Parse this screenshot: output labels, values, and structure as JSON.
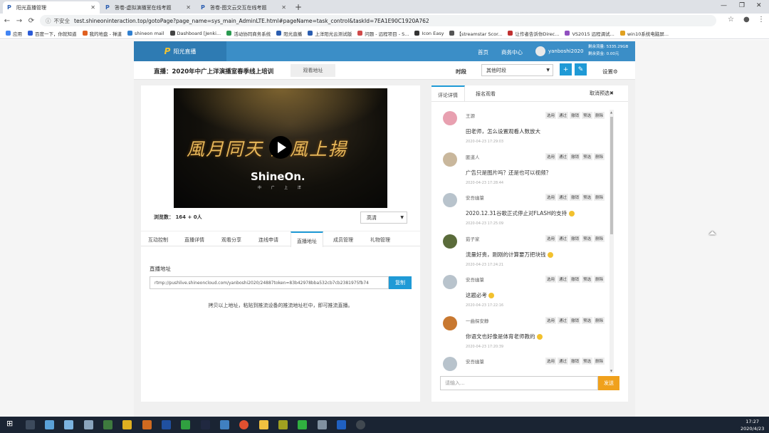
{
  "browser": {
    "tabs": [
      {
        "title": "阳光直播管理",
        "active": true
      },
      {
        "title": "答卷-虚拟演播室在线考题",
        "active": false
      },
      {
        "title": "答卷-图文云交互在线考题",
        "active": false
      }
    ],
    "insecure_label": "不安全",
    "url": "test.shineoninteraction.top/gotoPage?page_name=sys_main_AdminLTE.html#pageName=task_control&taskId=7EA1E90C1920A762",
    "bookmarks": [
      "应用",
      "百度一下，你就知道",
      "我的地盘 - 禅道",
      "shineon mail",
      "Dashboard [Jenki...",
      "活动协同商务系统",
      "阳光直播",
      "上洋阳光云测试版",
      "问题 - 远程项目 - S...",
      "Icon Easy",
      "【streamstar Scor...",
      "让作者告诉你Direc...",
      "VS2015 远程调试...",
      "win10系统电脑屏..."
    ]
  },
  "header": {
    "logo_text": "阳光直播",
    "nav_home": "首页",
    "nav_business": "商务中心",
    "username": "yanboshi2020",
    "flow_remaining": "剩余流量: 5335.29GB",
    "funds_remaining": "剩余资金: 0.00元"
  },
  "titlebar": {
    "title": "直播：2020年中广上洋演播室春季线上培训",
    "watch_addr_tab": "观看地址",
    "period_label": "时段",
    "period_value": "其他时段",
    "settings_label": "设置"
  },
  "player": {
    "calligraphy": "風月同天 迎風上揚",
    "brand": "ShineOn.",
    "brand_sub": "中 广 上 洋",
    "viewers_label": "浏览数：",
    "viewers_value": "164 + 0人",
    "quality": "高清"
  },
  "subtabs": [
    "互动控制",
    "直播详情",
    "观看分享",
    "连线申请",
    "直播地址",
    "成员管理",
    "礼物管理"
  ],
  "stream": {
    "label": "直播地址",
    "url": "rtmp://pushlive.shineoncloud.com/yanboshi2020/24887token=83b42978bba532cb7cb2381975fb74",
    "copy_label": "复制",
    "hint": "拷贝以上地址，粘贴到推流设备的推流地址栏中，即可推流直播。"
  },
  "chat": {
    "tabs": [
      "评论详情",
      "报名观看"
    ],
    "cancel_preselect": "取消预选",
    "actions": [
      "选用",
      "通过",
      "撤销",
      "预选",
      "删除"
    ],
    "comments": [
      {
        "name": "王源",
        "text": "田老师，怎么设置观看人数放大",
        "time": "2020-04-23 17:29:03",
        "emoji": false,
        "color": "#e8a0b0"
      },
      {
        "name": "匿道人",
        "text": "广告只是图片吗？还是也可以视频？",
        "time": "2020-04-23 17:28:44",
        "emoji": false,
        "color": "#c9b79c"
      },
      {
        "name": "安吾幽篁",
        "text": "2020.12.31谷歌正式停止对FLASH的支持",
        "time": "2020-04-23 17:25:09",
        "emoji": true,
        "color": "#b8c3cc"
      },
      {
        "name": "茹子家",
        "text": "流量好贵，刚刚的计算要万把块钱",
        "time": "2020-04-23 17:24:21",
        "emoji": true,
        "color": "#5a6b3a"
      },
      {
        "name": "安吾幽篁",
        "text": "这题必考",
        "time": "2020-04-23 17:22:16",
        "emoji": true,
        "color": "#b8c3cc"
      },
      {
        "name": "一曲探安静",
        "text": "你语文也好像是体育老师教的",
        "time": "2020-04-23 17:20:39",
        "emoji": true,
        "color": "#c87830"
      },
      {
        "name": "安吾幽篁",
        "text": "",
        "time": "",
        "emoji": false,
        "color": "#b8c3cc"
      }
    ],
    "input_placeholder": "请输入...",
    "send_label": "发送"
  },
  "taskbar": {
    "time": "17:27",
    "date": "2020/4/23"
  }
}
